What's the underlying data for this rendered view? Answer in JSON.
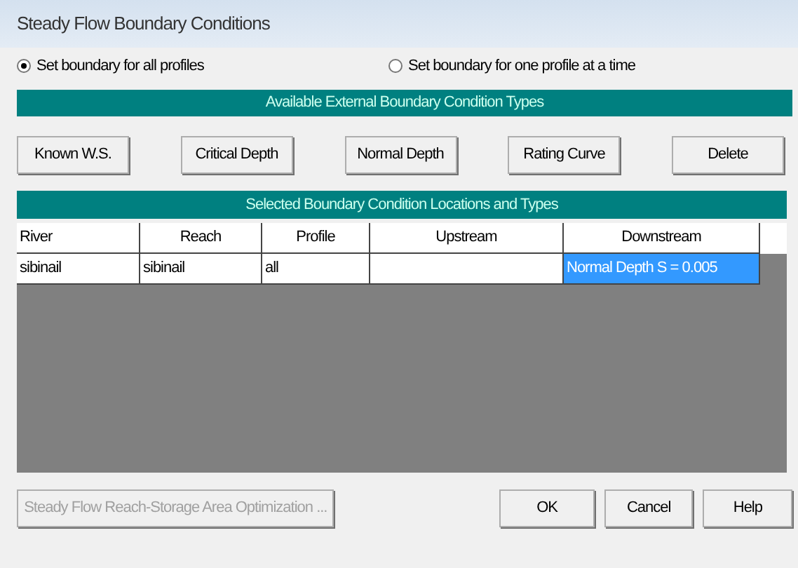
{
  "window": {
    "title": "Steady Flow Boundary Conditions"
  },
  "options": [
    {
      "label": "Set boundary for all profiles",
      "selected": true
    },
    {
      "label": "Set boundary for one profile at a time",
      "selected": false
    }
  ],
  "types_header": "Available External Boundary Condition Types",
  "type_buttons": [
    "Known W.S.",
    "Critical Depth",
    "Normal Depth",
    "Rating Curve",
    "Delete"
  ],
  "table": {
    "title": "Selected Boundary Condition Locations and Types",
    "columns": [
      "River",
      "Reach",
      "Profile",
      "Upstream",
      "Downstream"
    ],
    "rows": [
      {
        "cells": [
          {
            "text": "sibinail",
            "selected": false
          },
          {
            "text": "sibinail",
            "selected": false
          },
          {
            "text": "all",
            "selected": false
          },
          {
            "text": "",
            "selected": false
          },
          {
            "text": "Normal Depth S = 0.005",
            "selected": true
          }
        ]
      }
    ]
  },
  "footer_buttons": [
    {
      "label": "Steady Flow Reach-Storage Area Optimization ...",
      "disabled": true
    },
    {
      "label": "OK",
      "disabled": false
    },
    {
      "label": "Cancel",
      "disabled": false
    },
    {
      "label": "Help",
      "disabled": false
    }
  ]
}
